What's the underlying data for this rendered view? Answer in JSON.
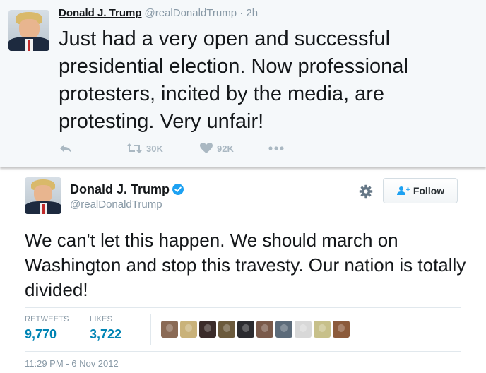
{
  "tweet1": {
    "name": "Donald J. Trump",
    "meta": "@realDonaldTrump · 2h",
    "text": "Just had a very open and successful presidential election. Now professional protesters, incited by the media, are protesting. Very unfair!",
    "retweets": "30K",
    "likes": "92K",
    "icons": [
      "reply-icon",
      "retweet-icon",
      "heart-icon",
      "more-icon"
    ],
    "action_color": "#aab8c2"
  },
  "tweet2": {
    "name": "Donald J. Trump",
    "handle": "@realDonaldTrump",
    "follow_label": "Follow",
    "text": "We can't let this happen. We should march on Washington and stop this travesty. Our nation is totally divided!",
    "retweets_label": "RETWEETS",
    "retweets_value": "9,770",
    "likes_label": "LIKES",
    "likes_value": "3,722",
    "timestamp": "11:29 PM - 6 Nov 2012",
    "liker_colors": [
      "#8a6a55",
      "#c9b27a",
      "#3b2c2a",
      "#6b5a3c",
      "#2b2b2f",
      "#7a5a4a",
      "#5c6b7a",
      "#d8d8d8",
      "#c7c08a",
      "#8c5a3a"
    ],
    "accent_color": "#0084b4",
    "verified_color": "#1da1f2"
  }
}
